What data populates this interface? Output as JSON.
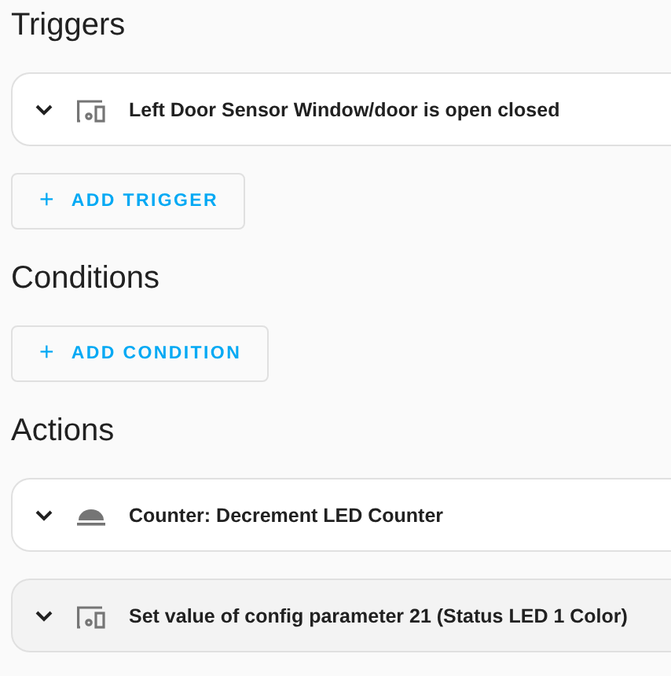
{
  "sections": [
    {
      "title": "Triggers",
      "cards": [
        {
          "kind": "device",
          "text": "Left Door Sensor Window/door is open closed",
          "highlighted": false
        }
      ],
      "button": {
        "icon": "+",
        "label": "ADD TRIGGER"
      }
    },
    {
      "title": "Conditions",
      "button": {
        "icon": "+",
        "label": "ADD CONDITION"
      }
    },
    {
      "title": "Actions",
      "cards": [
        {
          "kind": "counter",
          "text": "Counter: Decrement LED Counter",
          "highlighted": false
        },
        {
          "kind": "device",
          "text": "Set value of config parameter 21 (Status LED 1 Color)",
          "highlighted": true
        }
      ]
    }
  ]
}
